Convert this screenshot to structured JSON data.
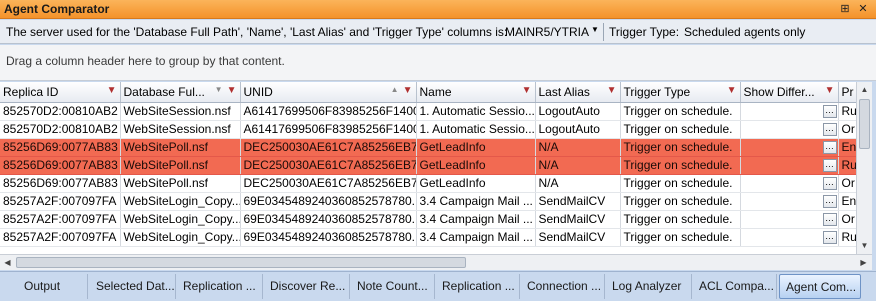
{
  "window": {
    "title": "Agent Comparator",
    "buttons": [
      "⊞",
      "✕"
    ]
  },
  "info": {
    "server_label": "The server used for the 'Database Full Path', 'Name', 'Last Alias' and 'Trigger Type' columns is:",
    "server_value": "MAINR5/YTRIA",
    "trigger_label": "Trigger Type:",
    "trigger_value": "Scheduled agents only"
  },
  "group_hint": "Drag a column header here to group by that content.",
  "grid": {
    "columns": [
      "Replica ID",
      "Database Ful...",
      "UNID",
      "Name",
      "Last Alias",
      "Trigger Type",
      "Show Differ...",
      "Pr"
    ],
    "rows": [
      {
        "replica": "852570D2:00810AB2",
        "db": "WebSiteSession.nsf",
        "unid": "A61417699506F83985256F1400...",
        "name": "1. Automatic Sessio...",
        "alias": "LogoutAuto",
        "trigger": "Trigger on schedule.",
        "pr": "Ru",
        "highlight": false
      },
      {
        "replica": "852570D2:00810AB2",
        "db": "WebSiteSession.nsf",
        "unid": "A61417699506F83985256F1400...",
        "name": "1. Automatic Sessio...",
        "alias": "LogoutAuto",
        "trigger": "Trigger on schedule.",
        "pr": "Or",
        "highlight": false
      },
      {
        "replica": "85256D69:0077AB83",
        "db": "WebSitePoll.nsf",
        "unid": "DEC250030AE61C7A85256EB70...",
        "name": "GetLeadInfo",
        "alias": "N/A",
        "trigger": "Trigger on schedule.",
        "pr": "En",
        "highlight": true
      },
      {
        "replica": "85256D69:0077AB83",
        "db": "WebSitePoll.nsf",
        "unid": "DEC250030AE61C7A85256EB70...",
        "name": "GetLeadInfo",
        "alias": "N/A",
        "trigger": "Trigger on schedule.",
        "pr": "Ru",
        "highlight": true
      },
      {
        "replica": "85256D69:0077AB83",
        "db": "WebSitePoll.nsf",
        "unid": "DEC250030AE61C7A85256EB70...",
        "name": "GetLeadInfo",
        "alias": "N/A",
        "trigger": "Trigger on schedule.",
        "pr": "Or",
        "highlight": false
      },
      {
        "replica": "85257A2F:007097FA",
        "db": "WebSiteLogin_Copy...",
        "unid": "69E0345489240360852578780...",
        "name": "3.4 Campaign Mail ...",
        "alias": "SendMailCV",
        "trigger": "Trigger on schedule.",
        "pr": "En",
        "highlight": false
      },
      {
        "replica": "85257A2F:007097FA",
        "db": "WebSiteLogin_Copy...",
        "unid": "69E0345489240360852578780...",
        "name": "3.4 Campaign Mail ...",
        "alias": "SendMailCV",
        "trigger": "Trigger on schedule.",
        "pr": "Or",
        "highlight": false
      },
      {
        "replica": "85257A2F:007097FA",
        "db": "WebSiteLogin_Copy...",
        "unid": "69E0345489240360852578780...",
        "name": "3.4 Campaign Mail ...",
        "alias": "SendMailCV",
        "trigger": "Trigger on schedule.",
        "pr": "Ru",
        "highlight": false
      }
    ]
  },
  "tabs": [
    "Output",
    "Selected Dat...",
    "Replication ...",
    "Discover Re...",
    "Note Count...",
    "Replication ...",
    "Connection ...",
    "Log Analyzer",
    "ACL Compa...",
    "Agent Com..."
  ],
  "colors": {
    "titlebar": "#f4922a",
    "highlight_row": "#f26a52",
    "tab_strip": "#c9d9ee"
  }
}
